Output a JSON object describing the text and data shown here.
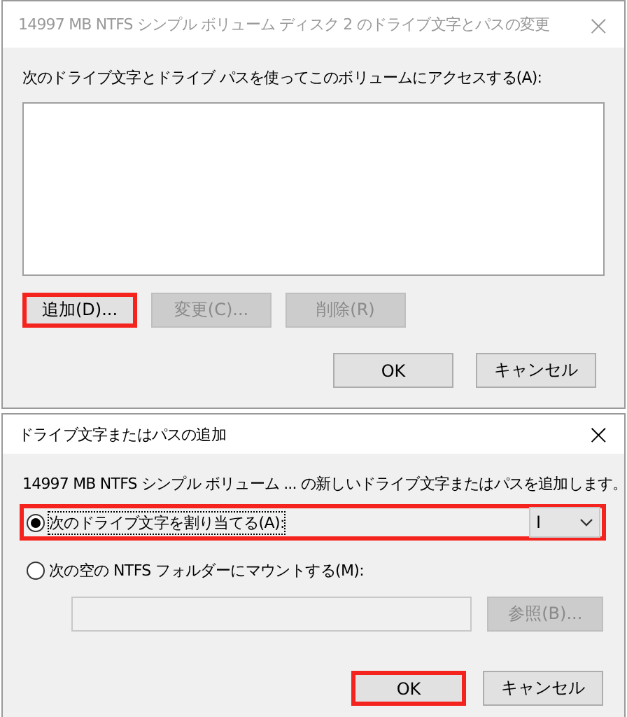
{
  "dialogs": [
    {
      "title": "14997 MB NTFS シンプル ボリューム ディスク 2 のドライブ文字とパスの変更",
      "title_active": false,
      "close": "×",
      "prompt": "次のドライブ文字とドライブ パスを使ってこのボリュームにアクセスする(A):",
      "action_buttons": [
        {
          "label": "追加(D)...",
          "disabled": false,
          "highlighted": true
        },
        {
          "label": "変更(C)...",
          "disabled": true,
          "highlighted": false
        },
        {
          "label": "削除(R)",
          "disabled": true,
          "highlighted": false
        }
      ],
      "footer_buttons": [
        {
          "label": "OK",
          "highlighted": false
        },
        {
          "label": "キャンセル",
          "highlighted": false
        }
      ]
    },
    {
      "title": "ドライブ文字またはパスの追加",
      "title_active": true,
      "close": "×",
      "prompt": "14997 MB NTFS シンプル ボリューム ... の新しいドライブ文字またはパスを追加します。",
      "options": [
        {
          "label": "次のドライブ文字を割り当てる(A):",
          "selected": true,
          "highlighted": true,
          "kind": "dropdown",
          "value": "I"
        },
        {
          "label": "次の空の NTFS フォルダーにマウントする(M):",
          "selected": false,
          "highlighted": false,
          "kind": "folder",
          "browse": "参照(B)..."
        }
      ],
      "footer_buttons": [
        {
          "label": "OK",
          "highlighted": true
        },
        {
          "label": "キャンセル",
          "highlighted": false
        }
      ]
    }
  ]
}
